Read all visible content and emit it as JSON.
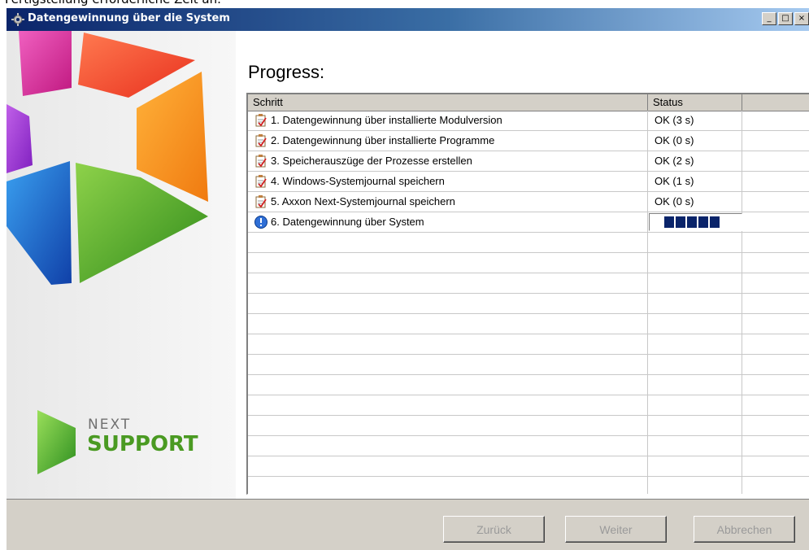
{
  "background_text": "Fertigstellung erforderliche Zeit an.",
  "window": {
    "title": "Datengewinnung über die System",
    "controls": {
      "minimize": "_",
      "maximize": "□",
      "close": "×"
    }
  },
  "brand": {
    "line1": "NEXT",
    "line2": "SUPPORT",
    "accent": "#5ea82a"
  },
  "main": {
    "heading": "Progress:",
    "columns": [
      "Schritt",
      "Status",
      ""
    ],
    "rows": [
      {
        "icon": "checklist-icon",
        "step": "1. Datengewinnung über installierte Modulversion",
        "status": "OK (3 s)"
      },
      {
        "icon": "checklist-icon",
        "step": "2. Datengewinnung über installierte Programme",
        "status": "OK (0 s)"
      },
      {
        "icon": "checklist-icon",
        "step": "3. Speicherauszüge der Prozesse erstellen",
        "status": "OK (2 s)"
      },
      {
        "icon": "checklist-icon",
        "step": "4. Windows-Systemjournal speichern",
        "status": "OK (1 s)"
      },
      {
        "icon": "checklist-icon",
        "step": "5. Axxon Next-Systemjournal speichern",
        "status": "OK (0 s)"
      },
      {
        "icon": "info-icon",
        "step": "6. Datengewinnung über System",
        "status": "",
        "progress_blocks": 5
      }
    ]
  },
  "buttons": {
    "back": "Zurück",
    "next": "Weiter",
    "cancel": "Abbrechen"
  }
}
